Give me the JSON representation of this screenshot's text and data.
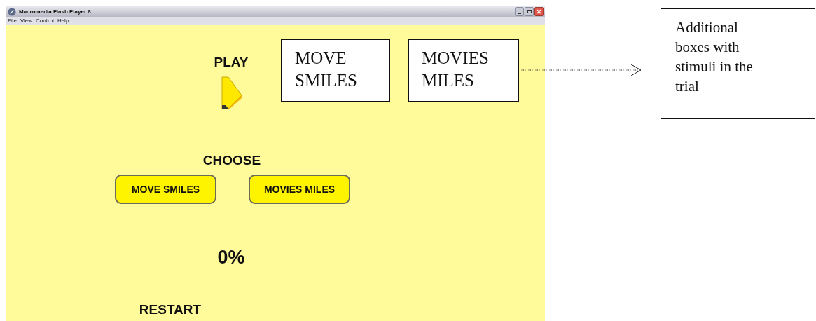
{
  "window": {
    "title": "Macromedia Flash Player 8",
    "menu": [
      "File",
      "View",
      "Control",
      "Help"
    ]
  },
  "stage": {
    "play_label": "PLAY",
    "choose_label": "CHOOSE",
    "choices": [
      "MOVE SMILES",
      "MOVIES MILES"
    ],
    "score": "0%",
    "restart": "RESTART"
  },
  "annotation": {
    "stimulus_boxes": [
      "MOVE SMILES",
      "MOVIES MILES"
    ],
    "callout": "Additional boxes with stimuli in the trial"
  }
}
